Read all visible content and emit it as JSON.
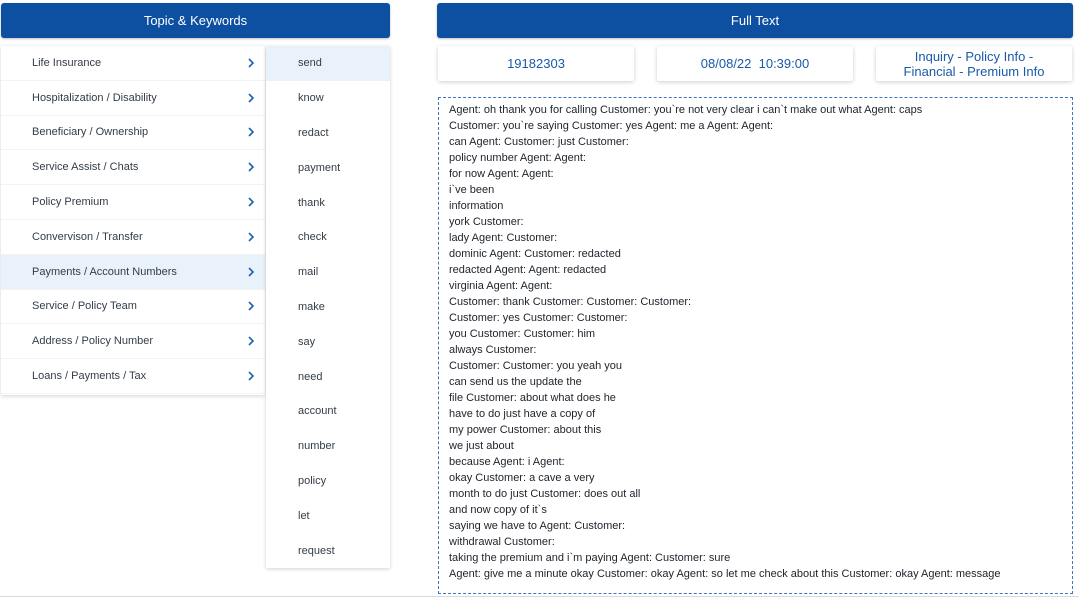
{
  "header": {
    "left_title": "Topic & Keywords",
    "right_title": "Full Text"
  },
  "topics": [
    {
      "label": "Life Insurance"
    },
    {
      "label": "Hospitalization / Disability"
    },
    {
      "label": "Beneficiary / Ownership"
    },
    {
      "label": "Service Assist / Chats"
    },
    {
      "label": "Policy Premium"
    },
    {
      "label": "Convervison / Transfer"
    },
    {
      "label": "Payments / Account Numbers",
      "selected": true
    },
    {
      "label": "Service / Policy Team"
    },
    {
      "label": "Address / Policy Number"
    },
    {
      "label": "Loans / Payments / Tax"
    }
  ],
  "keywords": [
    {
      "label": "send",
      "selected": true
    },
    {
      "label": "know"
    },
    {
      "label": "redact"
    },
    {
      "label": "payment"
    },
    {
      "label": "thank"
    },
    {
      "label": "check"
    },
    {
      "label": "mail"
    },
    {
      "label": "make"
    },
    {
      "label": "say"
    },
    {
      "label": "need"
    },
    {
      "label": "account"
    },
    {
      "label": "number"
    },
    {
      "label": "policy"
    },
    {
      "label": "let"
    },
    {
      "label": "request"
    }
  ],
  "info": {
    "id": "19182303",
    "datetime": "08/08/22  10:39:00",
    "category": "Inquiry - Policy Info - Financial - Premium Info"
  },
  "transcript": {
    "lines": [
      "Agent: oh thank you for calling Customer: you`re not very clear i can`t make out what Agent: caps",
      "Customer: you`re saying Customer: yes Agent: me a Agent: Agent:",
      "can Agent: Customer: just Customer:",
      "policy number Agent: Agent:",
      "for now Agent: Agent:",
      "i`ve been",
      "information",
      "york Customer:",
      "lady Agent: Customer:",
      "dominic Agent: Customer: redacted",
      "redacted Agent: Agent: redacted",
      "virginia Agent: Agent:",
      "Customer: thank Customer: Customer: Customer:",
      "Customer: yes Customer: Customer:",
      "you Customer: Customer: him",
      "always Customer:",
      "Customer: Customer: you yeah you",
      "can send us the update the",
      "file Customer: about what does he",
      "have to do just have a copy of",
      "my power Customer: about this",
      "we just about",
      "because Agent: i Agent:",
      "okay Customer: a cave a very",
      "month to do just Customer: does out all",
      "and now copy of it`s",
      "saying we have to Agent: Customer:",
      "withdrawal Customer:",
      "taking the premium and i`m paying Agent: Customer: sure",
      "Agent: give me a minute okay Customer: okay Agent: so let me check about this Customer: okay Agent: message"
    ]
  }
}
